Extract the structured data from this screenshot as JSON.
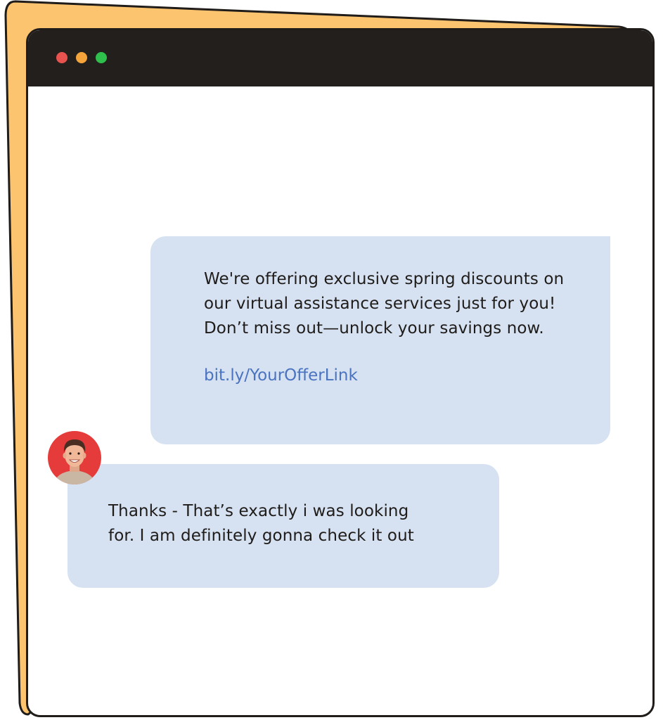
{
  "window": {
    "controls": [
      {
        "name": "close",
        "color": "#e8534f"
      },
      {
        "name": "minimize",
        "color": "#f5a43b"
      },
      {
        "name": "maximize",
        "color": "#2fbf4c"
      }
    ],
    "titlebar_color": "#221f1d",
    "backdrop_color": "#fdc46f"
  },
  "chat": {
    "messages": [
      {
        "sender": "business",
        "text": "We're offering exclusive spring discounts on our virtual assistance services just for you! Don’t miss out—unlock your savings now.",
        "link": "bit.ly/YourOfferLink",
        "bubble_color": "#d6e2f2"
      },
      {
        "sender": "customer",
        "text": "Thanks - That’s exactly i was looking for. I am definitely gonna check it out",
        "avatar": "avatar-icon",
        "bubble_color": "#d6e2f2"
      }
    ],
    "link_color": "#4a73c0"
  }
}
